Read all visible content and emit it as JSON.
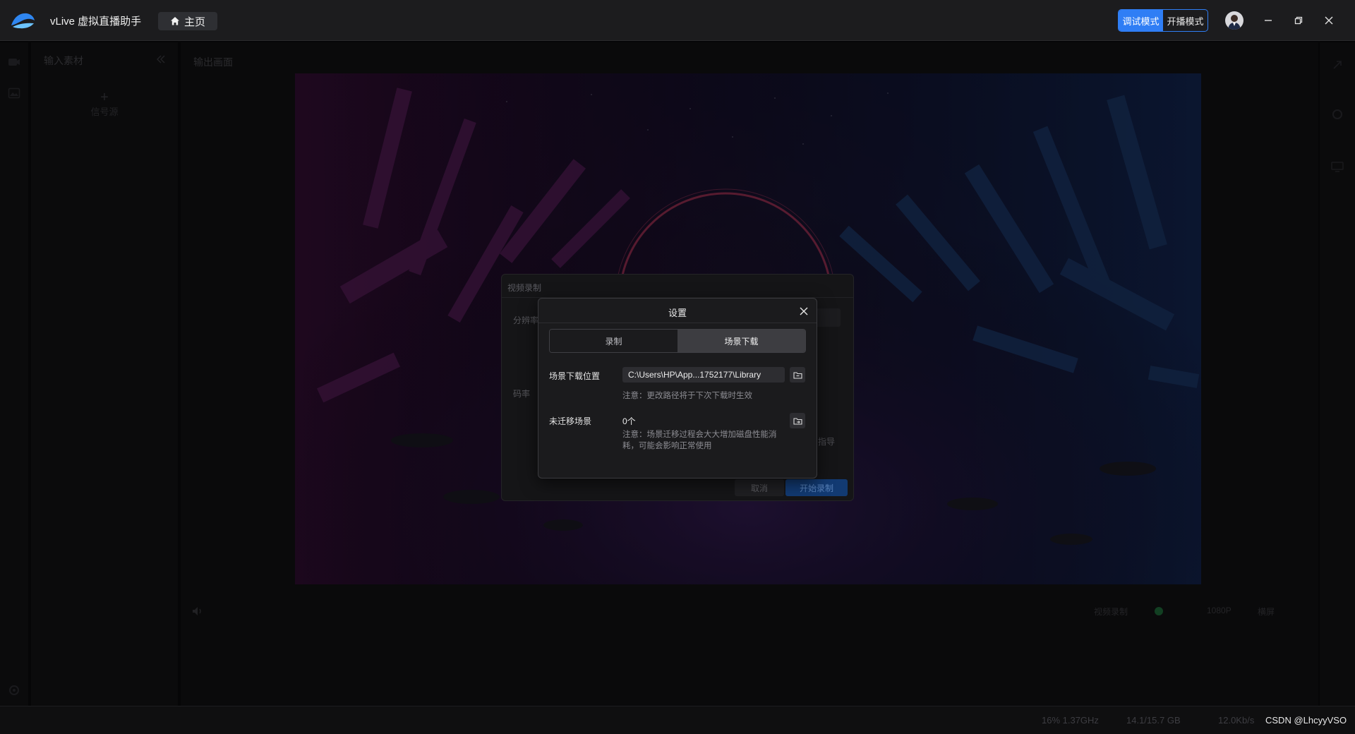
{
  "app": {
    "title": "vLive 虚拟直播助手",
    "home_label": "主页",
    "modes": [
      "调试模式",
      "开播模式"
    ],
    "active_mode": "调试模式",
    "accent_color": "#2f7ef5"
  },
  "left_panel": {
    "title": "输入素材",
    "add_source_label": "信号源"
  },
  "output_panel": {
    "title": "输出画面"
  },
  "bottom_bar": {
    "record_label": "视频录制",
    "resolution": "1080P",
    "orientation": "横屏"
  },
  "status_bar": {
    "cpu": "16% 1.37GHz",
    "memory": "14.1/15.7 GB",
    "network": "12.0Kb/s",
    "watermark": "CSDN @LhcyyVSO"
  },
  "record_dialog": {
    "title": "视频录制",
    "resolution_label": "分辨率",
    "bitrate_label": "码率",
    "side_text": "指导",
    "cancel_label": "取消",
    "start_label": "开始录制"
  },
  "settings_modal": {
    "title": "设置",
    "tabs": [
      "录制",
      "场景下载"
    ],
    "active_tab": "场景下载",
    "download_location_label": "场景下载位置",
    "download_path": "C:\\Users\\HP\\App...1752177\\Library",
    "path_note": "注意：更改路径将于下次下载时生效",
    "unmigrated_label": "未迁移场景",
    "unmigrated_count": "0个",
    "migrate_note_line1": "注意：场景迁移过程会大大增加磁盘性能消",
    "migrate_note_line2": "耗，可能会影响正常使用"
  }
}
